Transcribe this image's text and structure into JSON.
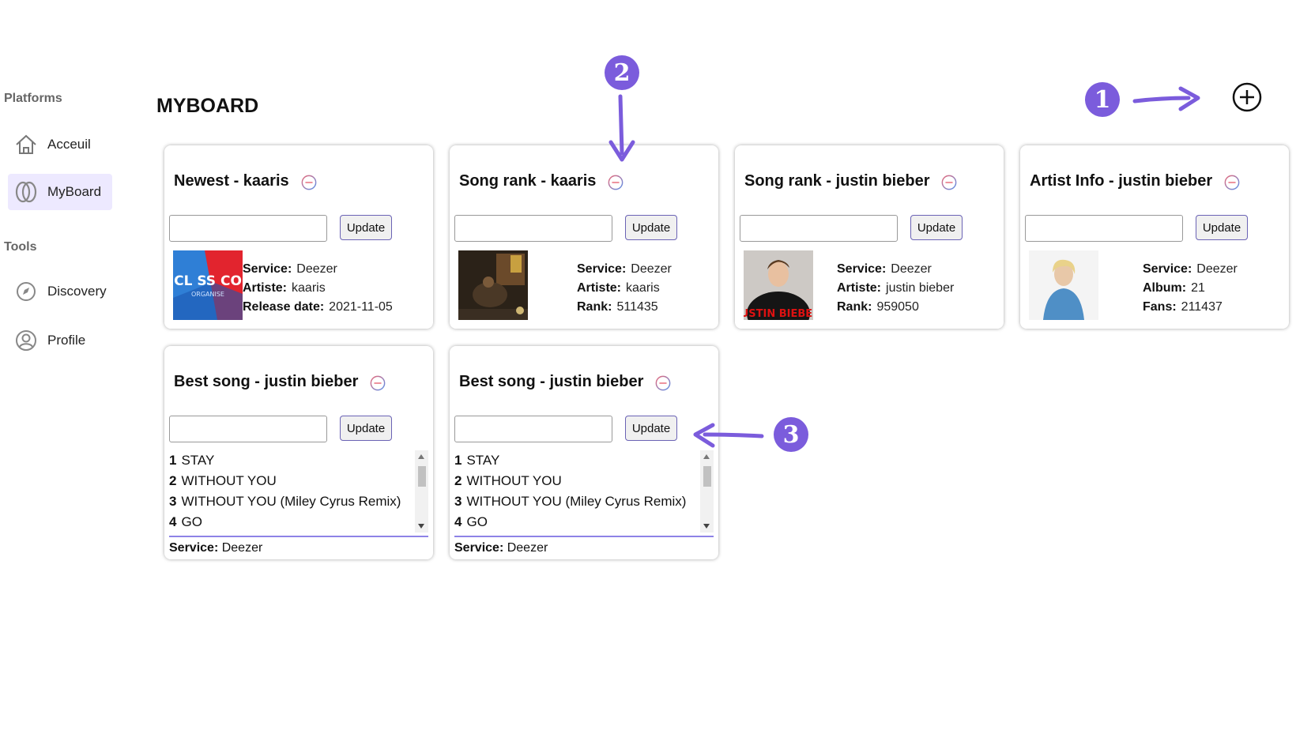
{
  "sidebar": {
    "section_platforms": "Platforms",
    "section_tools": "Tools",
    "items": [
      {
        "label": "Acceuil",
        "icon": "home-icon"
      },
      {
        "label": "MyBoard",
        "icon": "myboard-icon",
        "active": true
      },
      {
        "label": "Discovery",
        "icon": "compass-icon"
      },
      {
        "label": "Profile",
        "icon": "user-icon"
      }
    ]
  },
  "page": {
    "title": "MYBOARD"
  },
  "add_widget": {
    "icon": "plus-circle-icon"
  },
  "annotations": {
    "one": "1",
    "two": "2",
    "three": "3"
  },
  "widgets": [
    {
      "title": "Newest - kaaris",
      "input_value": "",
      "update_label": "Update",
      "image": "album-cover-le-classico",
      "fields": [
        {
          "key": "Service:",
          "value": "Deezer"
        },
        {
          "key": "Artiste:",
          "value": "kaaris"
        },
        {
          "key": "Release date:",
          "value": "2021-11-05"
        }
      ]
    },
    {
      "title": "Song rank - kaaris",
      "input_value": "",
      "update_label": "Update",
      "image": "artist-photo-kaaris",
      "fields": [
        {
          "key": "Service:",
          "value": "Deezer"
        },
        {
          "key": "Artiste:",
          "value": "kaaris"
        },
        {
          "key": "Rank:",
          "value": "511435"
        }
      ]
    },
    {
      "title": "Song rank - justin bieber",
      "input_value": "",
      "update_label": "Update",
      "image": "album-cover-justin-bieber",
      "fields": [
        {
          "key": "Service:",
          "value": "Deezer"
        },
        {
          "key": "Artiste:",
          "value": "justin bieber"
        },
        {
          "key": "Rank:",
          "value": "959050"
        }
      ]
    },
    {
      "title": "Artist Info - justin bieber",
      "input_value": "",
      "update_label": "Update",
      "image": "artist-photo-justin-bieber",
      "fields": [
        {
          "key": "Service:",
          "value": "Deezer"
        },
        {
          "key": "Album:",
          "value": "21"
        },
        {
          "key": "Fans:",
          "value": "211437"
        }
      ]
    },
    {
      "title": "Best song - justin bieber",
      "input_value": "",
      "update_label": "Update",
      "songs": [
        {
          "num": "1",
          "title": "STAY"
        },
        {
          "num": "2",
          "title": "WITHOUT YOU"
        },
        {
          "num": "3",
          "title": "WITHOUT YOU (Miley Cyrus Remix)"
        },
        {
          "num": "4",
          "title": "GO"
        }
      ],
      "service_key": "Service:",
      "service_value": "Deezer"
    },
    {
      "title": "Best song - justin bieber",
      "input_value": "",
      "update_label": "Update",
      "songs": [
        {
          "num": "1",
          "title": "STAY"
        },
        {
          "num": "2",
          "title": "WITHOUT YOU"
        },
        {
          "num": "3",
          "title": "WITHOUT YOU (Miley Cyrus Remix)"
        },
        {
          "num": "4",
          "title": "GO"
        }
      ],
      "service_key": "Service:",
      "service_value": "Deezer"
    }
  ],
  "colors": {
    "accent": "#7b5cdc",
    "active_nav_bg": "#ede9ff",
    "remove_icon_gradient": [
      "#e85a5a",
      "#5b8fe8"
    ]
  }
}
